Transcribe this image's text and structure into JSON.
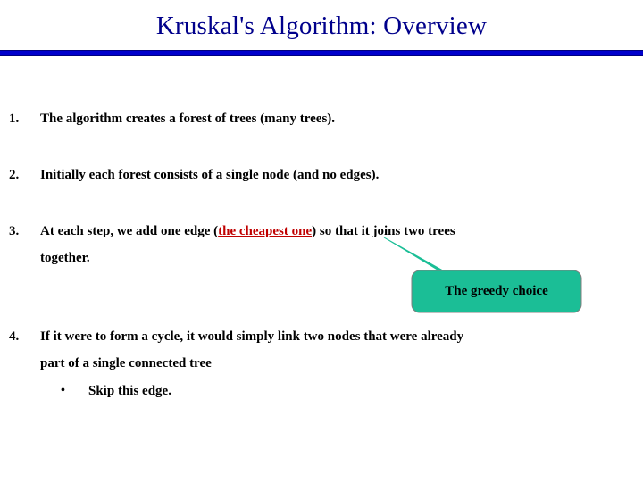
{
  "slide": {
    "title": "Kruskal's Algorithm: Overview",
    "accent_color": "#0000CC",
    "title_color": "#00008B",
    "highlight_color": "#C00000",
    "callout_color": "#1BBE96",
    "background_color": "#FFFFFF"
  },
  "items": [
    {
      "number": "1.",
      "text": "The algorithm creates a forest of trees (many trees)."
    },
    {
      "number": "2.",
      "text": "Initially each forest consists of a single node (and no edges)."
    },
    {
      "number": "3.",
      "text_before": "At each step, we add one edge (",
      "highlight": "the cheapest one",
      "text_after": ") so that it joins two trees",
      "continuation": "together."
    },
    {
      "number": "4.",
      "text": "If it were to form a cycle, it would simply link two nodes that were already",
      "continuation": "part of a single connected tree"
    }
  ],
  "subbullet": {
    "marker": "•",
    "text": "Skip this edge."
  },
  "callout": {
    "label": "The greedy choice"
  }
}
